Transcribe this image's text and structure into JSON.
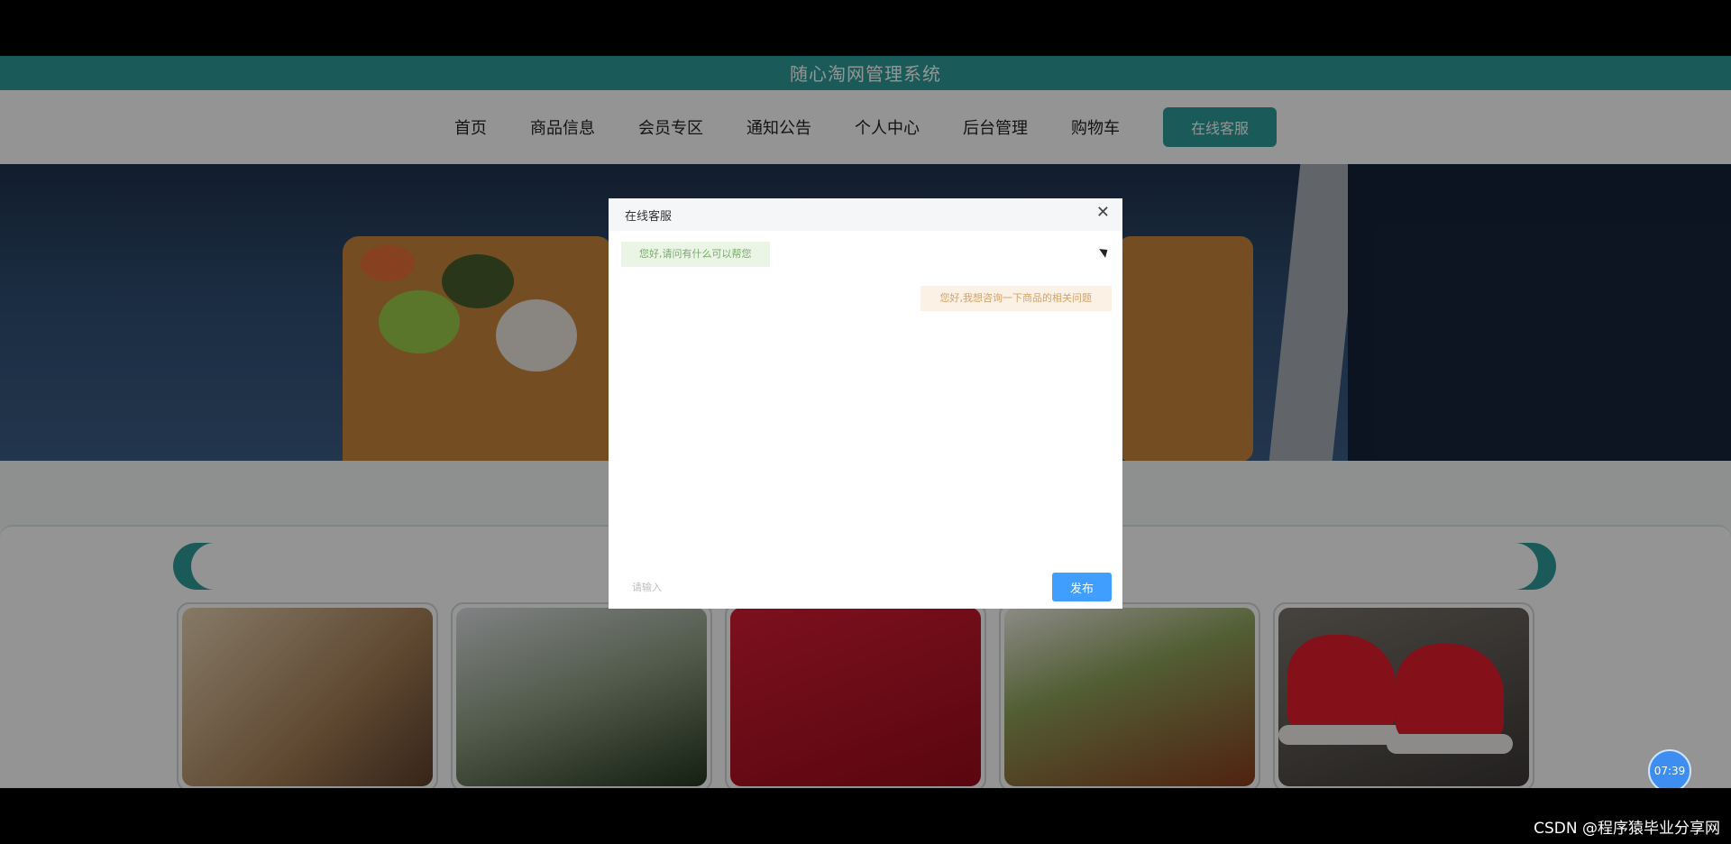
{
  "header": {
    "title": "随心淘网管理系统"
  },
  "nav": {
    "items": [
      "首页",
      "商品信息",
      "会员专区",
      "通知公告",
      "个人中心",
      "后台管理",
      "购物车"
    ],
    "service_button": "在线客服"
  },
  "modal": {
    "title": "在线客服",
    "messages": [
      {
        "side": "left",
        "text": "您好,请问有什么可以帮您"
      },
      {
        "side": "right",
        "text": "您好,我想咨询一下商品的相关问题"
      }
    ],
    "input_placeholder": "请输入",
    "publish_button": "发布"
  },
  "clock": "07:39",
  "watermark": "CSDN @程序猿毕业分享网",
  "colors": {
    "primary": "#2e9b99",
    "publish": "#409eff"
  }
}
